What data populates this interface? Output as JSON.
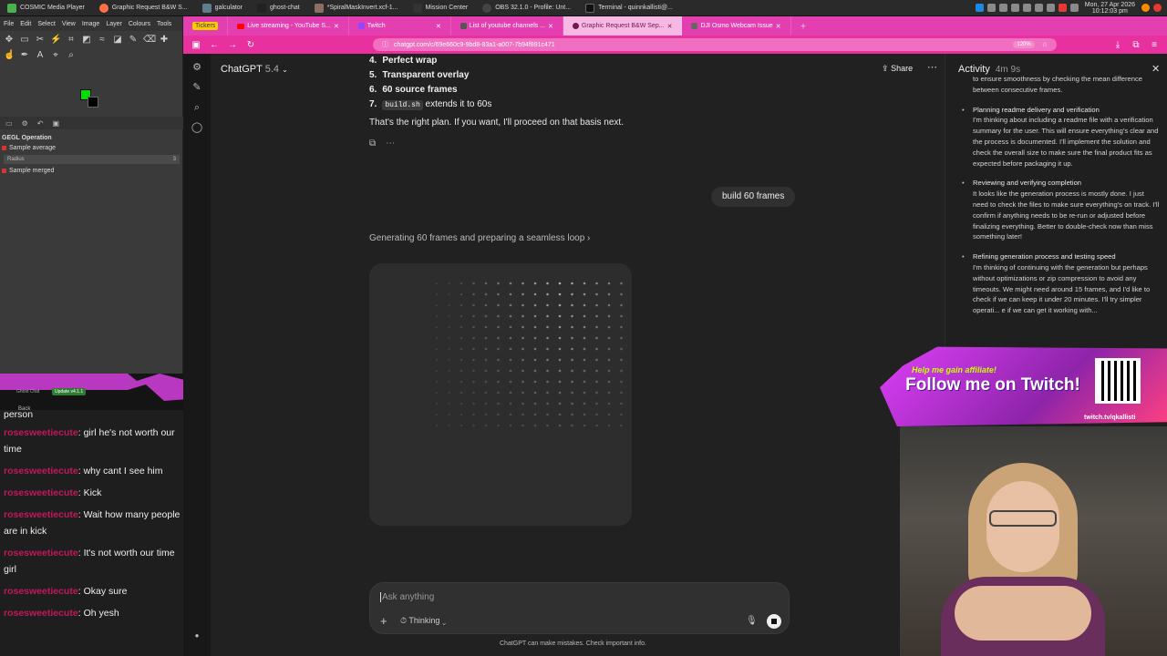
{
  "taskbar": {
    "tasks": [
      {
        "label": "COSMIC Media Player"
      },
      {
        "label": "Graphic Request B&W S..."
      },
      {
        "label": "galculator"
      },
      {
        "label": "ghost-chat"
      },
      {
        "label": "*SpiralMaskInvert.xcf-1..."
      },
      {
        "label": "Mission Center"
      },
      {
        "label": "OBS 32.1.0 - Profile: Unt..."
      },
      {
        "label": "Terminal - quinnkallisti@..."
      }
    ],
    "clock_line1": "Mon, 27 Apr 2026",
    "clock_line2": "10:12:03 pm"
  },
  "gimp": {
    "menu": [
      "File",
      "Edit",
      "Select",
      "View",
      "Image",
      "Layer",
      "Colours",
      "Tools"
    ],
    "operation_title": "GEGL Operation",
    "sample_average": "Sample average",
    "radius_label": "Radius",
    "radius_value": "3",
    "sample_merged": "Sample merged"
  },
  "ghost_chat": {
    "title": "Ghost Chat",
    "badge": "Update v4.1.1",
    "back": "Back",
    "partial_line": "person",
    "messages": [
      {
        "user": "rosesweetiecute",
        "text": "girl he's not worth our time"
      },
      {
        "user": "rosesweetiecute",
        "text": "why cant I see him"
      },
      {
        "user": "rosesweetiecute",
        "text": "Kick"
      },
      {
        "user": "rosesweetiecute",
        "text": "Wait how many people are in kick"
      },
      {
        "user": "rosesweetiecute",
        "text": "It's not worth our time girl"
      },
      {
        "user": "rosesweetiecute",
        "text": "Okay sure"
      },
      {
        "user": "rosesweetiecute",
        "text": "Oh yesh"
      }
    ]
  },
  "browser": {
    "tabs": [
      {
        "label": "Tickers",
        "badge": true
      },
      {
        "label": "Live streaming - YouTube S..."
      },
      {
        "label": "Twitch"
      },
      {
        "label": "List of youtube channels ..."
      },
      {
        "label": "Graphic Request B&W Sep...",
        "active": true
      },
      {
        "label": "DJI Osmo Webcam Issue"
      }
    ],
    "url": "chatgpt.com/c/69e660c9-9bd8-83a1-a007-7b94f891c471",
    "zoom": "120%"
  },
  "chatgpt": {
    "title": "ChatGPT",
    "version": "5.4",
    "share": "Share",
    "list": [
      {
        "num": "4.",
        "text": "Perfect wrap"
      },
      {
        "num": "5.",
        "text": "Transparent overlay"
      },
      {
        "num": "6.",
        "text": "60 source frames"
      }
    ],
    "item7_num": "7.",
    "item7_code": "build.sh",
    "item7_text": "extends it to 60s",
    "plan_text": "That's the right plan. If you want, I'll proceed on that basis next.",
    "user_message": "build 60 frames",
    "generating": "Generating 60 frames and preparing a seamless loop",
    "composer_placeholder": "Ask anything",
    "thinking": "Thinking",
    "disclaimer": "ChatGPT can make mistakes. Check important info."
  },
  "activity": {
    "title": "Activity",
    "time": "4m 9s",
    "cut_text": "to ensure smoothness by checking the mean difference between consecutive frames.",
    "items": [
      {
        "title": "Planning readme delivery and verification",
        "body": "I'm thinking about including a readme file with a verification summary for the user. This will ensure everything's clear and the process is documented. I'll implement the solution and check the overall size to make sure the final product fits as expected before packaging it up."
      },
      {
        "title": "Reviewing and verifying completion",
        "body": "It looks like the generation process is mostly done. I just need to check the files to make sure everything's on track. I'll confirm if anything needs to be re-run or adjusted before finalizing everything. Better to double-check now than miss something later!"
      },
      {
        "title": "Refining generation process and testing speed",
        "body": "I'm thinking of continuing with the generation but perhaps without optimizations or zip compression to avoid any timeouts. We might need around 15 frames, and I'd like to check if we can keep it under 20 minutes. I'll try simpler operati... e if we can get it working with..."
      }
    ]
  },
  "promo": {
    "line1": "Help me gain affiliate!",
    "line2": "Follow me on Twitch!",
    "url": "twitch.tv/qkallisti"
  }
}
